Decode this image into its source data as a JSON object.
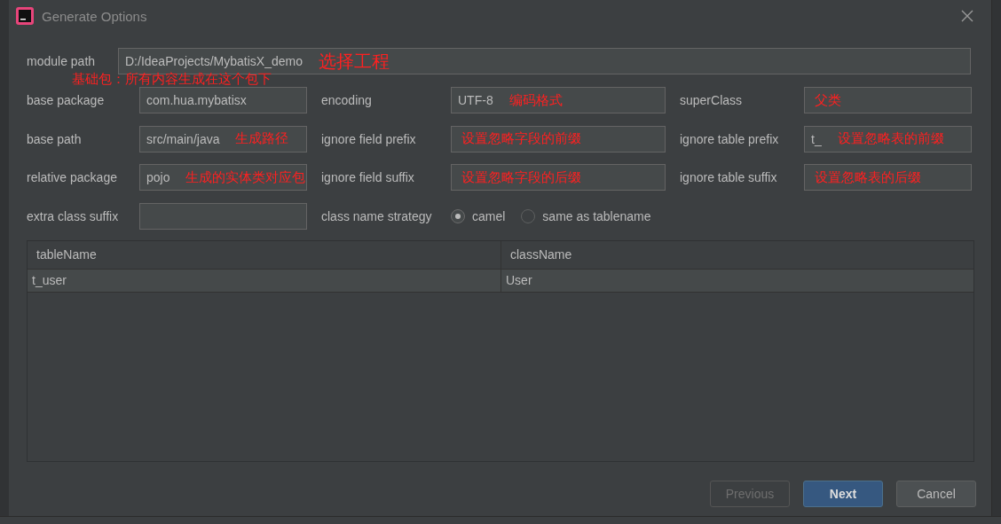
{
  "window": {
    "title": "Generate Options"
  },
  "module_path": {
    "label": "module path",
    "value": "D:/IdeaProjects/MybatisX_demo",
    "note": "选择工程"
  },
  "base_note": "基础包：所有内容生成在这个包下",
  "rows": [
    [
      {
        "kind": "text",
        "label": "base package",
        "value": "com.hua.mybatisx"
      },
      {
        "kind": "text",
        "label": "encoding",
        "value": "UTF-8",
        "note": "编码格式"
      },
      {
        "kind": "text",
        "label": "superClass",
        "note": "父类"
      }
    ],
    [
      {
        "kind": "text",
        "label": "base path",
        "value": "src/main/java",
        "note": "生成路径"
      },
      {
        "kind": "text",
        "label": "ignore field prefix",
        "note": "设置忽略字段的前缀"
      },
      {
        "kind": "text",
        "label": "ignore table prefix",
        "value": "t_",
        "note": "设置忽略表的前缀"
      }
    ],
    [
      {
        "kind": "text",
        "label": "relative package",
        "value": "pojo",
        "note": "生成的实体类对应包"
      },
      {
        "kind": "text",
        "label": "ignore field suffix",
        "note": "设置忽略字段的后缀"
      },
      {
        "kind": "text",
        "label": "ignore table suffix",
        "note": "设置忽略表的后缀"
      }
    ],
    [
      {
        "kind": "text",
        "label": "extra class suffix"
      },
      {
        "kind": "radio",
        "label": "class name strategy",
        "options": [
          {
            "label": "camel",
            "selected": true
          },
          {
            "label": "same as tablename",
            "selected": false
          }
        ]
      }
    ]
  ],
  "table": {
    "columns": [
      "tableName",
      "className"
    ],
    "rows": [
      [
        "t_user",
        "User"
      ]
    ]
  },
  "buttons": [
    {
      "label": "Previous",
      "disabled": true,
      "primary": false
    },
    {
      "label": "Next",
      "disabled": false,
      "primary": true
    },
    {
      "label": "Cancel",
      "disabled": false,
      "primary": false
    }
  ]
}
